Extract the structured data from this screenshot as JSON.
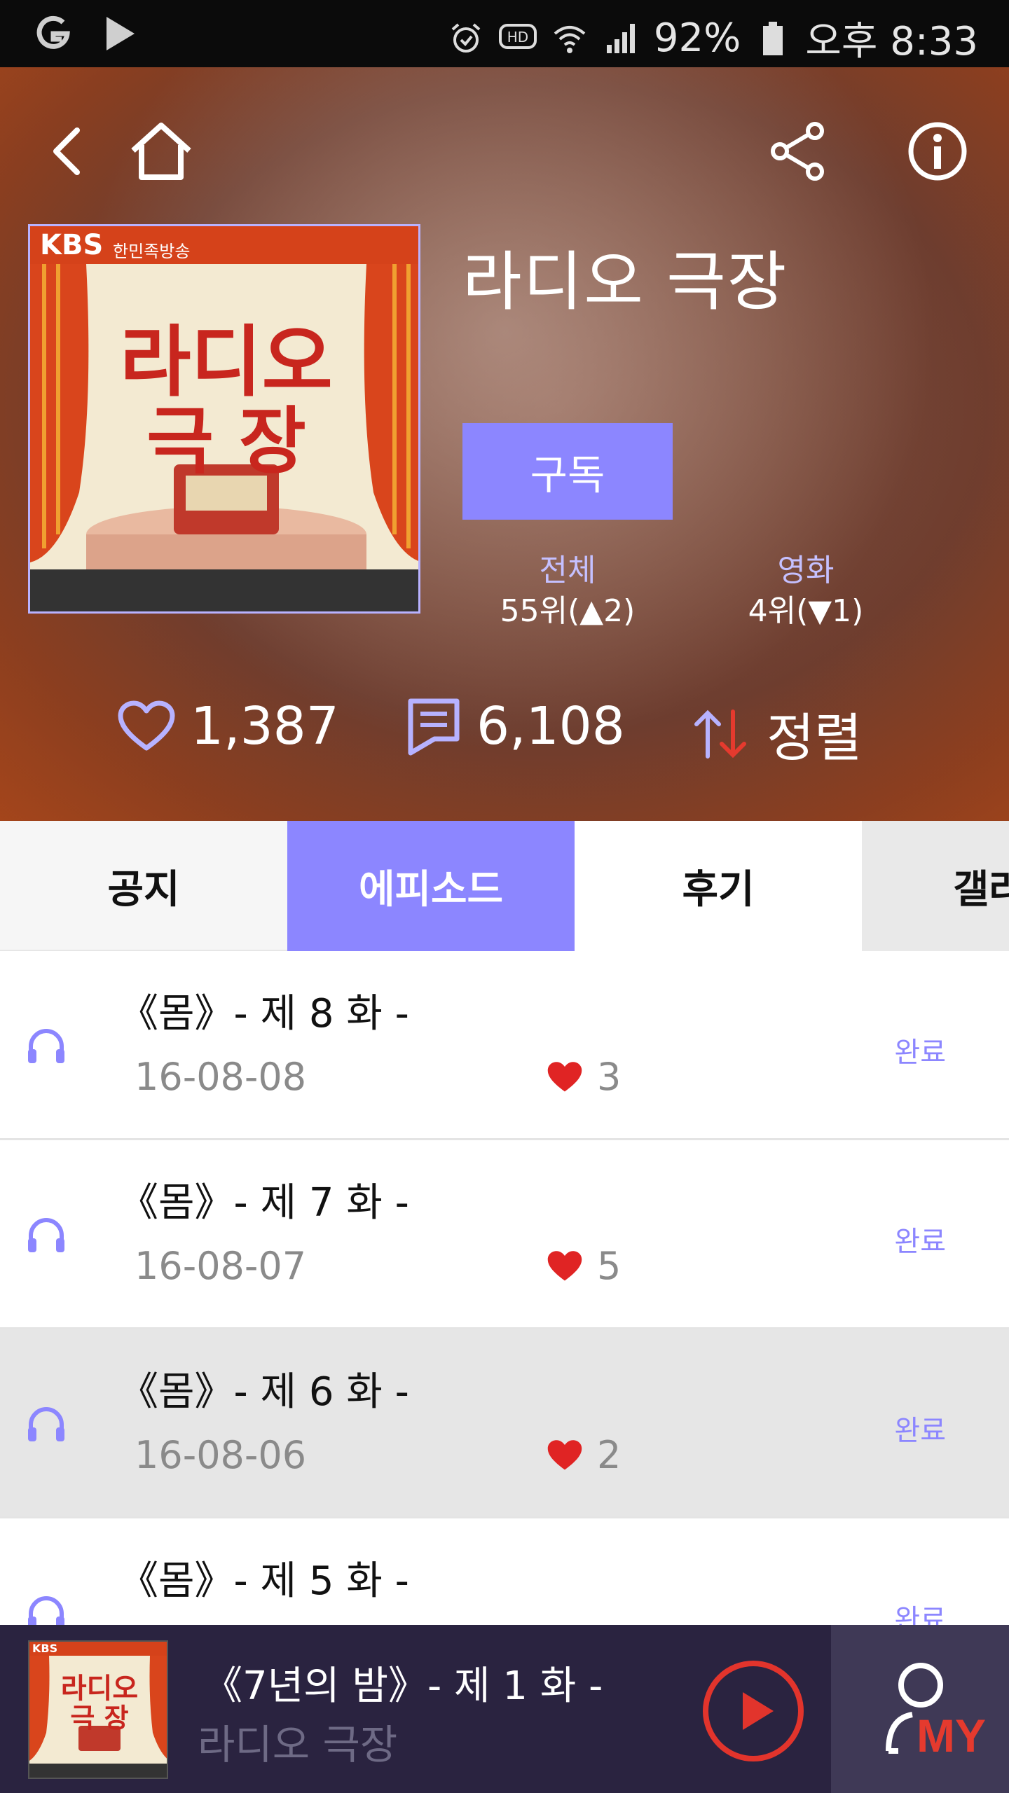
{
  "status_bar": {
    "battery_percent": "92%",
    "time": "오후 8:33",
    "icons": [
      "g-app-icon",
      "play-store-icon",
      "alarm-icon",
      "hd-call-icon",
      "wifi-icon",
      "signal-icon",
      "battery-icon"
    ]
  },
  "header": {
    "nav_icons": [
      "back-arrow-icon",
      "home-icon",
      "share-icon",
      "info-icon"
    ],
    "cover_texts": {
      "brand": "KBS",
      "brand_sub": "한민족방송",
      "line1": "라디오",
      "line2": "극 장"
    },
    "show_title": "라디오 극장",
    "subscribe_label": "구독",
    "ranks": [
      {
        "label": "전체",
        "value": "55위(▲2)"
      },
      {
        "label": "영화",
        "value": "4위(▼1)"
      }
    ],
    "likes_count": "1,387",
    "comments_count": "6,108",
    "sort_label": "정렬"
  },
  "tabs": [
    {
      "label": "공지",
      "active": false
    },
    {
      "label": "에피소드",
      "active": true
    },
    {
      "label": "후기",
      "active": false
    },
    {
      "label": "갤러",
      "active": false
    }
  ],
  "episodes": [
    {
      "title": "《몸》- 제 8 화 -",
      "date": "16-08-08",
      "likes": "3",
      "status": "완료"
    },
    {
      "title": "《몸》- 제 7 화 -",
      "date": "16-08-07",
      "likes": "5",
      "status": "완료"
    },
    {
      "title": "《몸》- 제 6 화 -",
      "date": "16-08-06",
      "likes": "2",
      "status": "완료"
    },
    {
      "title": "《몸》- 제 5 화 -",
      "date": "",
      "likes": "",
      "status": "완료"
    }
  ],
  "player": {
    "now_playing_title": "《7년의 밤》- 제 1 화 -",
    "show_name": "라디오 극장",
    "my_label": "MY"
  },
  "colors": {
    "accent": "#8c86ff",
    "heart": "#e02424",
    "play_red": "#e2342c",
    "player_bg": "#2a2340"
  }
}
